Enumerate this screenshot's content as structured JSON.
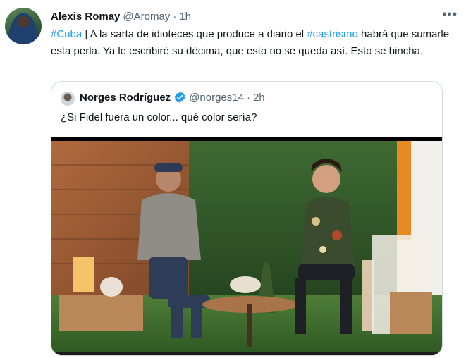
{
  "tweet": {
    "author_name": "Alexis Romay",
    "handle": "@Aromay",
    "separator": "·",
    "time": "1h",
    "more_icon": "more-horizontal-icon",
    "text_parts": {
      "hashtag1": "#Cuba",
      "part1": " | A la sarta de idioteces que produce a diario el ",
      "hashtag2": "#castrismo",
      "part2": " habrá que sumarle esta perla. Ya le escribiré su décima, que esto no se queda así. Esto se hincha."
    }
  },
  "quoted_tweet": {
    "author_name": "Norges Rodríguez",
    "verified_icon": "verified-badge-icon",
    "handle": "@norges14",
    "separator": "·",
    "time": "2h",
    "text": "¿Si Fidel fuera un color... qué color sería?"
  },
  "colors": {
    "hashtag": "#1d9bf0",
    "muted": "#536471",
    "border": "#cfd9de",
    "verified": "#1d9bf0"
  }
}
